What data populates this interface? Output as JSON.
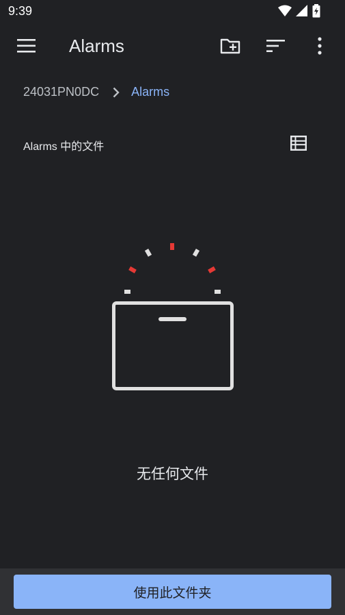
{
  "status_bar": {
    "time": "9:39",
    "icons": [
      "wifi-icon",
      "signal-icon",
      "battery-charging-icon"
    ]
  },
  "app_bar": {
    "title": "Alarms",
    "icons": [
      "menu-icon",
      "new-folder-icon",
      "sort-icon",
      "more-vert-icon"
    ]
  },
  "breadcrumb": {
    "root": "24031PN0DC",
    "current": "Alarms"
  },
  "section": {
    "title": "Alarms 中的文件",
    "view_icon": "list-view-icon"
  },
  "empty_state": {
    "message": "无任何文件"
  },
  "bottom": {
    "button_label": "使用此文件夹"
  },
  "colors": {
    "background": "#202124",
    "accent": "#8ab4f8",
    "alert_red": "#e53935",
    "bottom_bar": "#303134"
  }
}
